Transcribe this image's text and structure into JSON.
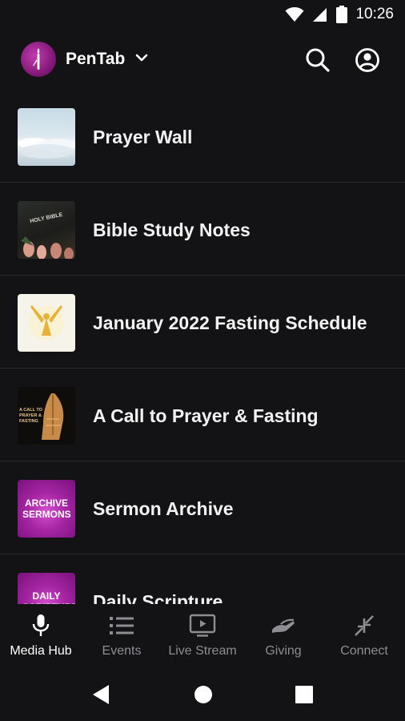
{
  "status_bar": {
    "time": "10:26"
  },
  "header": {
    "app_name": "PenTab",
    "icons": [
      "app-logo",
      "chevron-down-icon",
      "search-icon",
      "account-icon"
    ]
  },
  "list": {
    "items": [
      {
        "label": "Prayer Wall",
        "thumb": "clouds-image"
      },
      {
        "label": "Bible Study Notes",
        "thumb": "bible-image",
        "thumb_text": "HOLY BIBLE"
      },
      {
        "label": "January 2022 Fasting Schedule",
        "thumb": "raised-hands-image"
      },
      {
        "label": "A Call to Prayer & Fasting",
        "thumb": "praying-hands-image",
        "thumb_text": "A CALL TO PRAYER & FASTING"
      },
      {
        "label": "Sermon Archive",
        "thumb": "archive-sermons-image",
        "thumb_text": "ARCHIVE SERMONS"
      },
      {
        "label": "Daily Scripture",
        "thumb": "daily-scriptures-image",
        "thumb_text": "DAILY SCRIPTURES"
      }
    ]
  },
  "bottom_nav": {
    "items": [
      {
        "label": "Media Hub",
        "icon": "microphone-icon",
        "active": true
      },
      {
        "label": "Events",
        "icon": "list-icon",
        "active": false
      },
      {
        "label": "Live Stream",
        "icon": "tv-play-icon",
        "active": false
      },
      {
        "label": "Giving",
        "icon": "giving-hand-icon",
        "active": false
      },
      {
        "label": "Connect",
        "icon": "connect-arrows-icon",
        "active": false
      }
    ]
  },
  "colors": {
    "background": "#131315",
    "divider": "#2a2a2d",
    "inactive": "#8e8e92",
    "brand": "#9c1f8f"
  }
}
